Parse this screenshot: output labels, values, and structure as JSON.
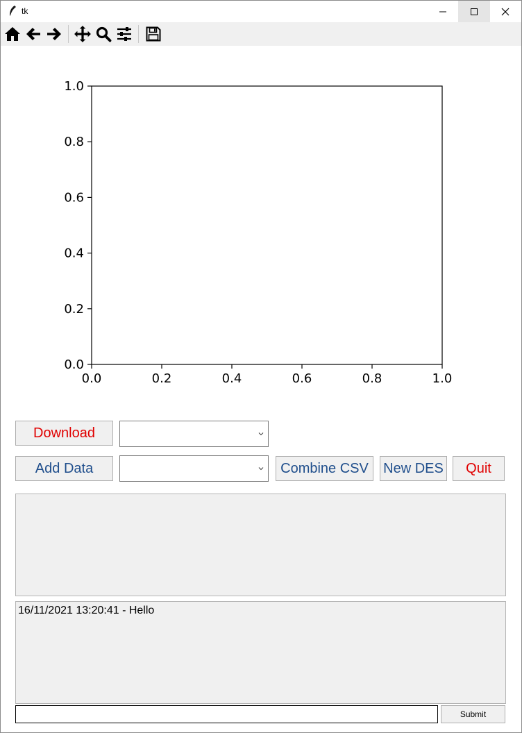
{
  "window": {
    "title": "tk"
  },
  "toolbar": {
    "icons": [
      "home-icon",
      "back-arrow-icon",
      "forward-arrow-icon",
      "pan-icon",
      "zoom-icon",
      "configure-subplots-icon",
      "save-icon"
    ]
  },
  "chart_data": {
    "type": "line",
    "title": "",
    "xlabel": "",
    "ylabel": "",
    "xlim": [
      0.0,
      1.0
    ],
    "ylim": [
      0.0,
      1.0
    ],
    "x_ticks": [
      "0.0",
      "0.2",
      "0.4",
      "0.6",
      "0.8",
      "1.0"
    ],
    "y_ticks": [
      "0.0",
      "0.2",
      "0.4",
      "0.6",
      "0.8",
      "1.0"
    ],
    "series": []
  },
  "controls": {
    "download_label": "Download",
    "add_data_label": "Add Data",
    "combine_csv_label": "Combine CSV",
    "new_des_label": "New DES",
    "quit_label": "Quit",
    "dropdown1_value": "",
    "dropdown2_value": ""
  },
  "colors": {
    "red_text": "#e00000",
    "blue_text": "#1f4e8c"
  },
  "log": {
    "lines": [
      "16/11/2021 13:20:41 - Hello"
    ]
  },
  "input": {
    "value": "",
    "submit_label": "Submit"
  }
}
